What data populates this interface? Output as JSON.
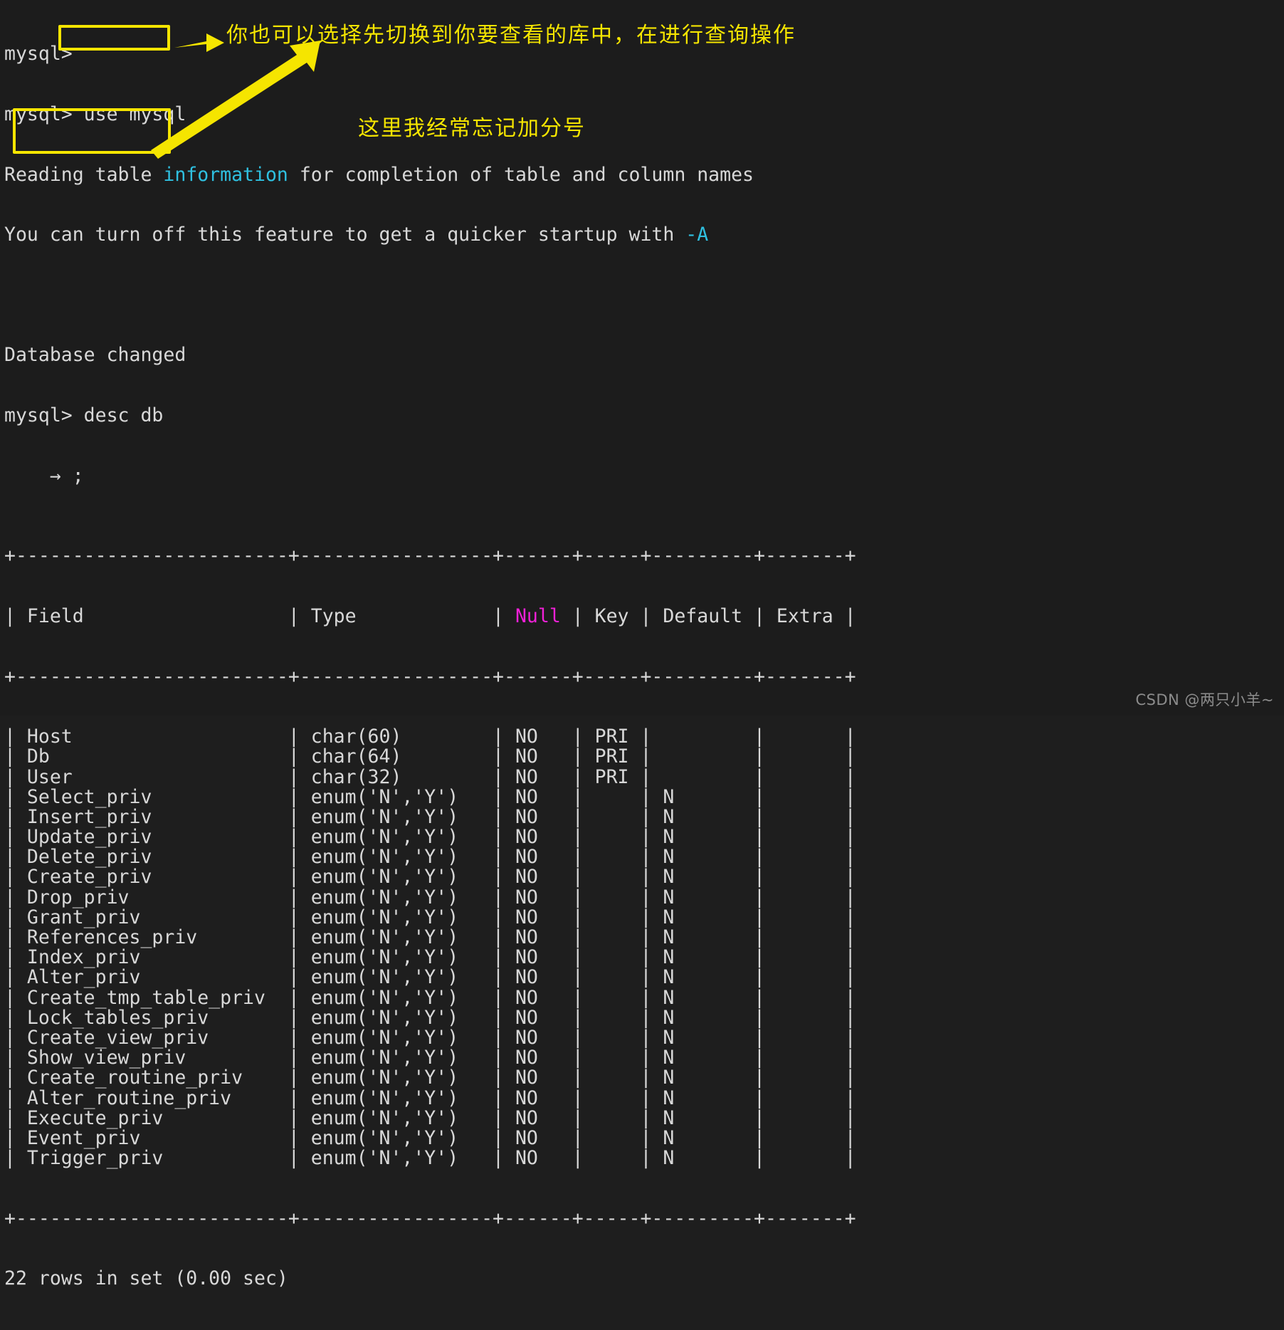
{
  "terminal": {
    "prompt": "mysql>",
    "lines": [
      {
        "id": "l1",
        "text": "mysql>"
      },
      {
        "id": "l2",
        "text": "mysql> use mysql"
      },
      {
        "id": "l3",
        "pre": "Reading table ",
        "hl": "information",
        "post": " for completion of table and column names",
        "hlcolor": "cyan"
      },
      {
        "id": "l4",
        "pre": "You can turn off this feature to get a quicker startup with ",
        "hl": "-A",
        "post": "",
        "hlcolor": "cyan"
      },
      {
        "id": "l5",
        "text": ""
      },
      {
        "id": "l6",
        "text": "Database changed"
      },
      {
        "id": "l7",
        "text": "mysql> desc db"
      },
      {
        "id": "l8",
        "text": "    → ;"
      }
    ],
    "footer": "22 rows in set (0.00 sec)"
  },
  "table": {
    "rule": "+------------------------+-----------------+------+-----+---------+-------+",
    "header": {
      "field": "Field",
      "type": "Type",
      "null": "Null",
      "key": "Key",
      "default": "Default",
      "extra": "Extra"
    },
    "rows": [
      {
        "field": "Host",
        "type": "char(60)",
        "null": "NO",
        "key": "PRI",
        "default": "",
        "extra": ""
      },
      {
        "field": "Db",
        "type": "char(64)",
        "null": "NO",
        "key": "PRI",
        "default": "",
        "extra": ""
      },
      {
        "field": "User",
        "type": "char(32)",
        "null": "NO",
        "key": "PRI",
        "default": "",
        "extra": ""
      },
      {
        "field": "Select_priv",
        "type": "enum('N','Y')",
        "null": "NO",
        "key": "",
        "default": "N",
        "extra": ""
      },
      {
        "field": "Insert_priv",
        "type": "enum('N','Y')",
        "null": "NO",
        "key": "",
        "default": "N",
        "extra": ""
      },
      {
        "field": "Update_priv",
        "type": "enum('N','Y')",
        "null": "NO",
        "key": "",
        "default": "N",
        "extra": ""
      },
      {
        "field": "Delete_priv",
        "type": "enum('N','Y')",
        "null": "NO",
        "key": "",
        "default": "N",
        "extra": ""
      },
      {
        "field": "Create_priv",
        "type": "enum('N','Y')",
        "null": "NO",
        "key": "",
        "default": "N",
        "extra": ""
      },
      {
        "field": "Drop_priv",
        "type": "enum('N','Y')",
        "null": "NO",
        "key": "",
        "default": "N",
        "extra": ""
      },
      {
        "field": "Grant_priv",
        "type": "enum('N','Y')",
        "null": "NO",
        "key": "",
        "default": "N",
        "extra": ""
      },
      {
        "field": "References_priv",
        "type": "enum('N','Y')",
        "null": "NO",
        "key": "",
        "default": "N",
        "extra": ""
      },
      {
        "field": "Index_priv",
        "type": "enum('N','Y')",
        "null": "NO",
        "key": "",
        "default": "N",
        "extra": ""
      },
      {
        "field": "Alter_priv",
        "type": "enum('N','Y')",
        "null": "NO",
        "key": "",
        "default": "N",
        "extra": ""
      },
      {
        "field": "Create_tmp_table_priv",
        "type": "enum('N','Y')",
        "null": "NO",
        "key": "",
        "default": "N",
        "extra": ""
      },
      {
        "field": "Lock_tables_priv",
        "type": "enum('N','Y')",
        "null": "NO",
        "key": "",
        "default": "N",
        "extra": ""
      },
      {
        "field": "Create_view_priv",
        "type": "enum('N','Y')",
        "null": "NO",
        "key": "",
        "default": "N",
        "extra": ""
      },
      {
        "field": "Show_view_priv",
        "type": "enum('N','Y')",
        "null": "NO",
        "key": "",
        "default": "N",
        "extra": ""
      },
      {
        "field": "Create_routine_priv",
        "type": "enum('N','Y')",
        "null": "NO",
        "key": "",
        "default": "N",
        "extra": ""
      },
      {
        "field": "Alter_routine_priv",
        "type": "enum('N','Y')",
        "null": "NO",
        "key": "",
        "default": "N",
        "extra": ""
      },
      {
        "field": "Execute_priv",
        "type": "enum('N','Y')",
        "null": "NO",
        "key": "",
        "default": "N",
        "extra": ""
      },
      {
        "field": "Event_priv",
        "type": "enum('N','Y')",
        "null": "NO",
        "key": "",
        "default": "N",
        "extra": ""
      },
      {
        "field": "Trigger_priv",
        "type": "enum('N','Y')",
        "null": "NO",
        "key": "",
        "default": "N",
        "extra": ""
      }
    ]
  },
  "annotations": {
    "note_top": "你也可以选择先切换到你要查看的库中，在进行查询操作",
    "note_mid": "这里我经常忘记加分号"
  },
  "watermark": "CSDN @两只小羊~",
  "colors": {
    "background": "#1c1c1c",
    "foreground": "#d8d8d8",
    "accent_yellow": "#f5e500",
    "cyan": "#2fc0e0",
    "magenta": "#f221d8"
  }
}
